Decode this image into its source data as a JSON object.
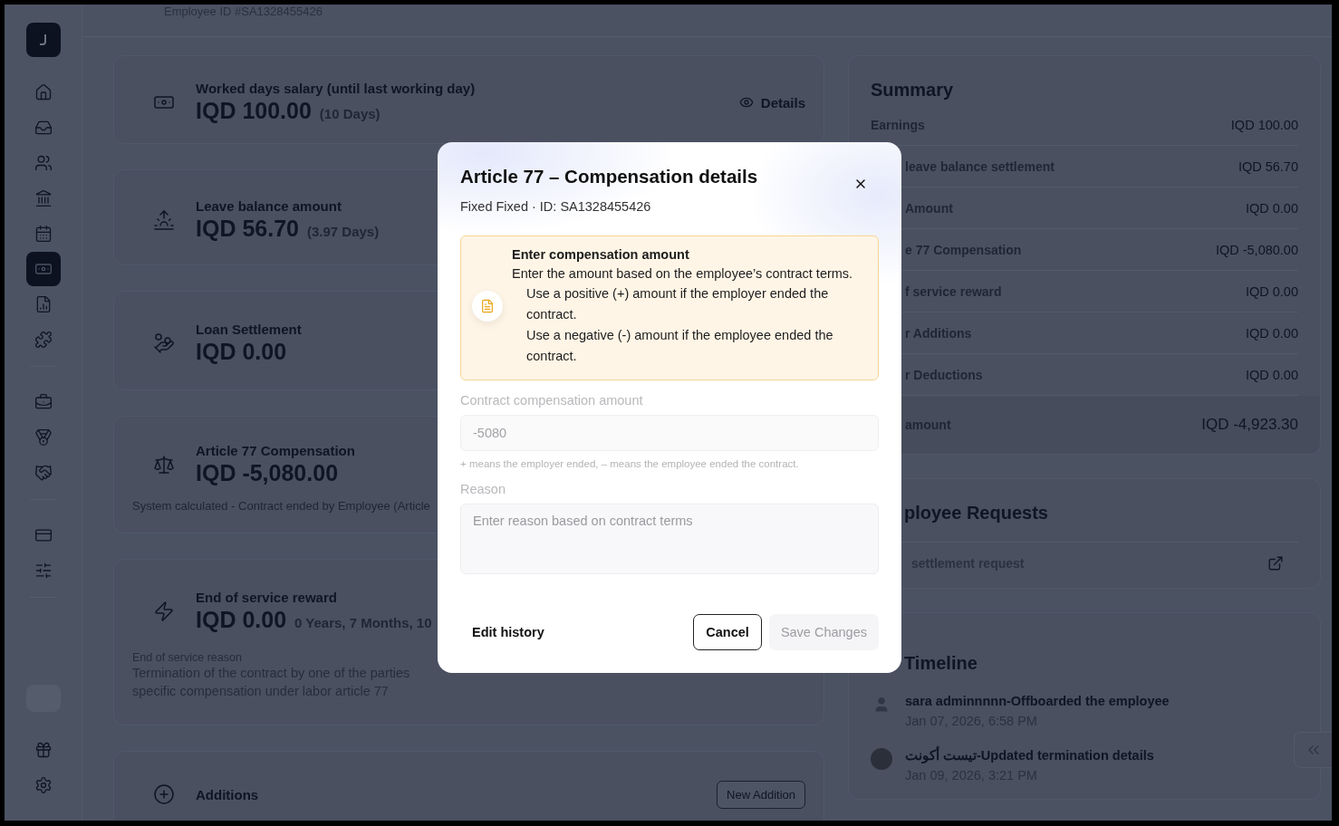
{
  "header": {
    "employee_id": "Employee ID #SA1328455426"
  },
  "sidebar": {
    "groups": [
      [
        {
          "selected": false
        },
        {
          "selected": false
        },
        {
          "selected": false
        },
        {
          "selected": false
        },
        {
          "selected": false
        },
        {
          "selected": true
        },
        {
          "selected": false
        },
        {
          "selected": false
        }
      ],
      [
        {
          "selected": false
        },
        {
          "selected": false
        },
        {
          "selected": false
        }
      ],
      [
        {
          "selected": false
        },
        {
          "selected": false
        }
      ]
    ],
    "bottom": [
      {
        "selected": false
      },
      {
        "selected": false
      }
    ]
  },
  "cards": [
    {
      "kind": "amount",
      "title": "Worked days salary (until last working day)",
      "amount": "IQD 100.00",
      "note": "(10 Days)",
      "action": "Details"
    },
    {
      "kind": "amount",
      "title": "Leave balance amount",
      "amount": "IQD 56.70",
      "note": "(3.97 Days)"
    },
    {
      "kind": "amount",
      "title": "Loan Settlement",
      "amount": "IQD 0.00"
    },
    {
      "kind": "amount",
      "title": "Article 77 Compensation",
      "amount": "IQD -5,080.00",
      "description": "System calculated - Contract ended by Employee (Article"
    },
    {
      "kind": "amount",
      "title": "End of service reward",
      "amount": "IQD 0.00",
      "note": "0 Years, 7 Months, 10",
      "reason_label": "End of service reason",
      "reason_lines": [
        "Termination of the contract by one of the parties",
        "specific compensation under labor article 77"
      ]
    },
    {
      "kind": "section",
      "title": "Additions",
      "button": "New Addition"
    }
  ],
  "summary": {
    "title": "Summary",
    "rows": [
      {
        "label": "Earnings",
        "value": "IQD 100.00"
      },
      {
        "label": "leave balance settlement",
        "value": "IQD 56.70"
      },
      {
        "label": "Amount",
        "value": "IQD 0.00"
      },
      {
        "label": "e 77 Compensation",
        "value": "IQD -5,080.00"
      },
      {
        "label": "f service reward",
        "value": "IQD 0.00"
      },
      {
        "label": "r Additions",
        "value": "IQD 0.00"
      },
      {
        "label": "r Deductions",
        "value": "IQD 0.00"
      }
    ],
    "total": {
      "label": "amount",
      "value": "IQD -4,923.30"
    }
  },
  "requests": {
    "title": "ployee Requests",
    "items": [
      {
        "label": "settlement request"
      }
    ]
  },
  "timeline": {
    "title": "Timeline",
    "events": [
      {
        "kind": "person",
        "text": "sara adminnnnn-Offboarded the employee",
        "time": "Jan 07, 2026, 6:58 PM"
      },
      {
        "kind": "photo",
        "text": "تيست أكونت-Updated termination details",
        "time": "Jan 09, 2026, 3:21 PM"
      }
    ]
  },
  "modal": {
    "title": "Article 77 – Compensation details",
    "subtitle": "Fixed Fixed · ID: SA1328455426",
    "info": {
      "title": "Enter compensation amount",
      "text": "Enter the amount based on the employee’s contract terms.",
      "bullets": [
        "Use a positive (+) amount if the employer ended the contract.",
        "Use a negative (-) amount if the employee ended the contract."
      ]
    },
    "amount_field": {
      "label": "Contract compensation amount",
      "value": "-5080",
      "disabled": true,
      "hint": "+ means the employer ended, – means the employee ended the contract."
    },
    "reason_field": {
      "label": "Reason",
      "placeholder": "Enter reason based on contract terms",
      "disabled": true
    },
    "edit_history": "Edit history",
    "buttons": [
      {
        "kind": "outline",
        "label": "Cancel",
        "disabled": false
      },
      {
        "kind": "primary",
        "label": "Save Changes",
        "disabled": true
      }
    ]
  }
}
